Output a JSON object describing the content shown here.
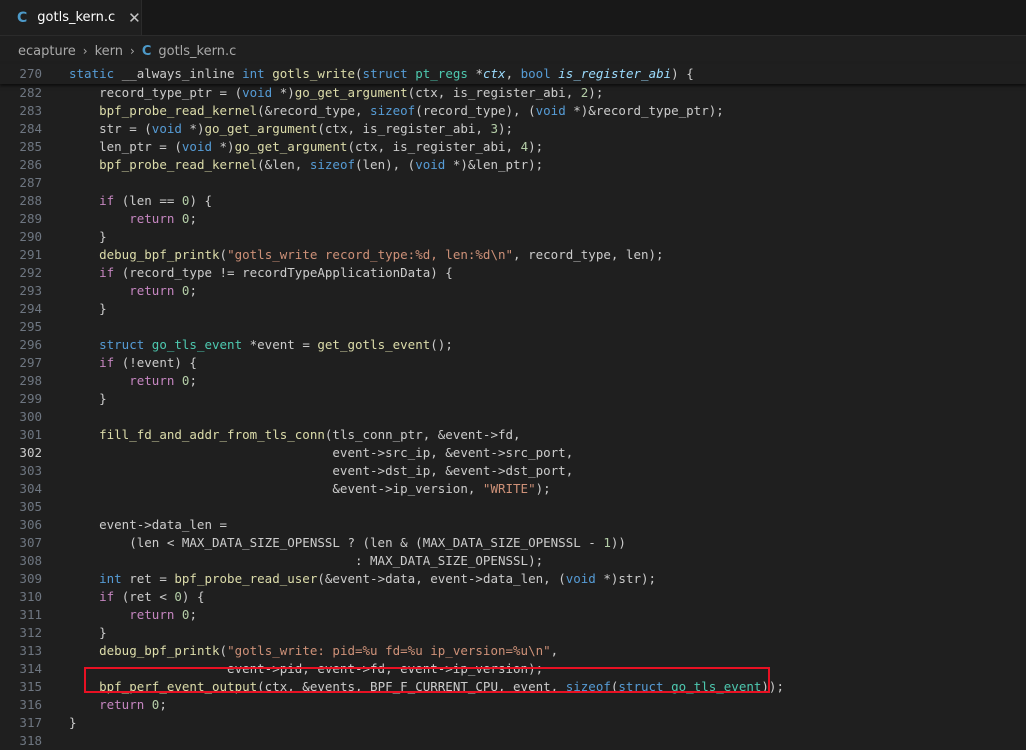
{
  "tab": {
    "icon": "C",
    "label": "gotls_kern.c",
    "close": "✕"
  },
  "breadcrumb": {
    "items": [
      "ecapture",
      "kern"
    ],
    "file_icon": "C",
    "file": "gotls_kern.c",
    "sep": "›"
  },
  "sticky": {
    "line": "270",
    "tokens": [
      [
        "k",
        "static "
      ],
      [
        "t",
        "__always_inline "
      ],
      [
        "k",
        "int "
      ],
      [
        "f",
        "gotls_write"
      ],
      [
        "t",
        "("
      ],
      [
        "k",
        "struct "
      ],
      [
        "ty",
        "pt_regs "
      ],
      [
        "t",
        "*"
      ],
      [
        "pi",
        "ctx"
      ],
      [
        "t",
        ", "
      ],
      [
        "k",
        "bool "
      ],
      [
        "pi",
        "is_register_abi"
      ],
      [
        "t",
        ") {"
      ]
    ]
  },
  "lines": [
    {
      "n": "282",
      "tokens": [
        [
          "t",
          "    record_type_ptr = ("
        ],
        [
          "k",
          "void"
        ],
        [
          "t",
          " *)"
        ],
        [
          "f",
          "go_get_argument"
        ],
        [
          "t",
          "(ctx, is_register_abi, "
        ],
        [
          "n",
          "2"
        ],
        [
          "t",
          ");"
        ]
      ]
    },
    {
      "n": "283",
      "tokens": [
        [
          "t",
          "    "
        ],
        [
          "f",
          "bpf_probe_read_kernel"
        ],
        [
          "t",
          "(&record_type, "
        ],
        [
          "k",
          "sizeof"
        ],
        [
          "t",
          "(record_type), ("
        ],
        [
          "k",
          "void"
        ],
        [
          "t",
          " *)&record_type_ptr);"
        ]
      ]
    },
    {
      "n": "284",
      "tokens": [
        [
          "t",
          "    str = ("
        ],
        [
          "k",
          "void"
        ],
        [
          "t",
          " *)"
        ],
        [
          "f",
          "go_get_argument"
        ],
        [
          "t",
          "(ctx, is_register_abi, "
        ],
        [
          "n",
          "3"
        ],
        [
          "t",
          ");"
        ]
      ]
    },
    {
      "n": "285",
      "tokens": [
        [
          "t",
          "    len_ptr = ("
        ],
        [
          "k",
          "void"
        ],
        [
          "t",
          " *)"
        ],
        [
          "f",
          "go_get_argument"
        ],
        [
          "t",
          "(ctx, is_register_abi, "
        ],
        [
          "n",
          "4"
        ],
        [
          "t",
          ");"
        ]
      ]
    },
    {
      "n": "286",
      "tokens": [
        [
          "t",
          "    "
        ],
        [
          "f",
          "bpf_probe_read_kernel"
        ],
        [
          "t",
          "(&len, "
        ],
        [
          "k",
          "sizeof"
        ],
        [
          "t",
          "(len), ("
        ],
        [
          "k",
          "void"
        ],
        [
          "t",
          " *)&len_ptr);"
        ]
      ]
    },
    {
      "n": "287",
      "tokens": []
    },
    {
      "n": "288",
      "tokens": [
        [
          "t",
          "    "
        ],
        [
          "kw",
          "if"
        ],
        [
          "t",
          " (len == "
        ],
        [
          "n",
          "0"
        ],
        [
          "t",
          ") {"
        ]
      ]
    },
    {
      "n": "289",
      "tokens": [
        [
          "t",
          "        "
        ],
        [
          "kw",
          "return"
        ],
        [
          "t",
          " "
        ],
        [
          "n",
          "0"
        ],
        [
          "t",
          ";"
        ]
      ]
    },
    {
      "n": "290",
      "tokens": [
        [
          "t",
          "    }"
        ]
      ]
    },
    {
      "n": "291",
      "tokens": [
        [
          "t",
          "    "
        ],
        [
          "f",
          "debug_bpf_printk"
        ],
        [
          "t",
          "("
        ],
        [
          "s",
          "\"gotls_write record_type:%d, len:%d\\n\""
        ],
        [
          "t",
          ", record_type, len);"
        ]
      ]
    },
    {
      "n": "292",
      "tokens": [
        [
          "t",
          "    "
        ],
        [
          "kw",
          "if"
        ],
        [
          "t",
          " (record_type != recordTypeApplicationData) {"
        ]
      ]
    },
    {
      "n": "293",
      "tokens": [
        [
          "t",
          "        "
        ],
        [
          "kw",
          "return"
        ],
        [
          "t",
          " "
        ],
        [
          "n",
          "0"
        ],
        [
          "t",
          ";"
        ]
      ]
    },
    {
      "n": "294",
      "tokens": [
        [
          "t",
          "    }"
        ]
      ]
    },
    {
      "n": "295",
      "tokens": []
    },
    {
      "n": "296",
      "tokens": [
        [
          "t",
          "    "
        ],
        [
          "k",
          "struct"
        ],
        [
          "t",
          " "
        ],
        [
          "ty",
          "go_tls_event"
        ],
        [
          "t",
          " *event = "
        ],
        [
          "f",
          "get_gotls_event"
        ],
        [
          "t",
          "();"
        ]
      ]
    },
    {
      "n": "297",
      "tokens": [
        [
          "t",
          "    "
        ],
        [
          "kw",
          "if"
        ],
        [
          "t",
          " (!event) {"
        ]
      ]
    },
    {
      "n": "298",
      "tokens": [
        [
          "t",
          "        "
        ],
        [
          "kw",
          "return"
        ],
        [
          "t",
          " "
        ],
        [
          "n",
          "0"
        ],
        [
          "t",
          ";"
        ]
      ]
    },
    {
      "n": "299",
      "tokens": [
        [
          "t",
          "    }"
        ]
      ]
    },
    {
      "n": "300",
      "tokens": []
    },
    {
      "n": "301",
      "tokens": [
        [
          "t",
          "    "
        ],
        [
          "f",
          "fill_fd_and_addr_from_tls_conn"
        ],
        [
          "t",
          "(tls_conn_ptr, &event->fd,"
        ]
      ]
    },
    {
      "n": "302",
      "active": true,
      "tokens": [
        [
          "t",
          "                                   event->src_ip, &event->src_port,"
        ]
      ]
    },
    {
      "n": "303",
      "tokens": [
        [
          "t",
          "                                   event->dst_ip, &event->dst_port,"
        ]
      ]
    },
    {
      "n": "304",
      "tokens": [
        [
          "t",
          "                                   &event->ip_version, "
        ],
        [
          "s",
          "\"WRITE\""
        ],
        [
          "t",
          ");"
        ]
      ]
    },
    {
      "n": "305",
      "tokens": []
    },
    {
      "n": "306",
      "tokens": [
        [
          "t",
          "    event->data_len ="
        ]
      ]
    },
    {
      "n": "307",
      "tokens": [
        [
          "t",
          "        (len < MAX_DATA_SIZE_OPENSSL ? (len & (MAX_DATA_SIZE_OPENSSL - "
        ],
        [
          "n",
          "1"
        ],
        [
          "t",
          "))"
        ]
      ]
    },
    {
      "n": "308",
      "tokens": [
        [
          "t",
          "                                      : MAX_DATA_SIZE_OPENSSL);"
        ]
      ]
    },
    {
      "n": "309",
      "tokens": [
        [
          "t",
          "    "
        ],
        [
          "k",
          "int"
        ],
        [
          "t",
          " ret = "
        ],
        [
          "f",
          "bpf_probe_read_user"
        ],
        [
          "t",
          "(&event->data, event->data_len, ("
        ],
        [
          "k",
          "void"
        ],
        [
          "t",
          " *)str);"
        ]
      ]
    },
    {
      "n": "310",
      "tokens": [
        [
          "t",
          "    "
        ],
        [
          "kw",
          "if"
        ],
        [
          "t",
          " (ret < "
        ],
        [
          "n",
          "0"
        ],
        [
          "t",
          ") {"
        ]
      ]
    },
    {
      "n": "311",
      "tokens": [
        [
          "t",
          "        "
        ],
        [
          "kw",
          "return"
        ],
        [
          "t",
          " "
        ],
        [
          "n",
          "0"
        ],
        [
          "t",
          ";"
        ]
      ]
    },
    {
      "n": "312",
      "tokens": [
        [
          "t",
          "    }"
        ]
      ]
    },
    {
      "n": "313",
      "tokens": [
        [
          "t",
          "    "
        ],
        [
          "f",
          "debug_bpf_printk"
        ],
        [
          "t",
          "("
        ],
        [
          "s",
          "\"gotls_write: pid=%u fd=%u ip_version=%u\\n\""
        ],
        [
          "t",
          ","
        ]
      ]
    },
    {
      "n": "314",
      "tokens": [
        [
          "t",
          "                     event->pid, event->fd, event->ip_version);"
        ]
      ]
    },
    {
      "n": "315",
      "tokens": [
        [
          "t",
          "    "
        ],
        [
          "f",
          "bpf_perf_event_output"
        ],
        [
          "t",
          "(ctx, &events, BPF_F_CURRENT_CPU, event, "
        ],
        [
          "k",
          "sizeof"
        ],
        [
          "t",
          "("
        ],
        [
          "k",
          "struct"
        ],
        [
          "t",
          " "
        ],
        [
          "ty",
          "go_tls_event"
        ],
        [
          "t",
          "));"
        ]
      ]
    },
    {
      "n": "316",
      "tokens": [
        [
          "t",
          "    "
        ],
        [
          "kw",
          "return"
        ],
        [
          "t",
          " "
        ],
        [
          "n",
          "0"
        ],
        [
          "t",
          ";"
        ]
      ]
    },
    {
      "n": "317",
      "tokens": [
        [
          "t",
          "}"
        ]
      ]
    },
    {
      "n": "318",
      "tokens": []
    }
  ]
}
